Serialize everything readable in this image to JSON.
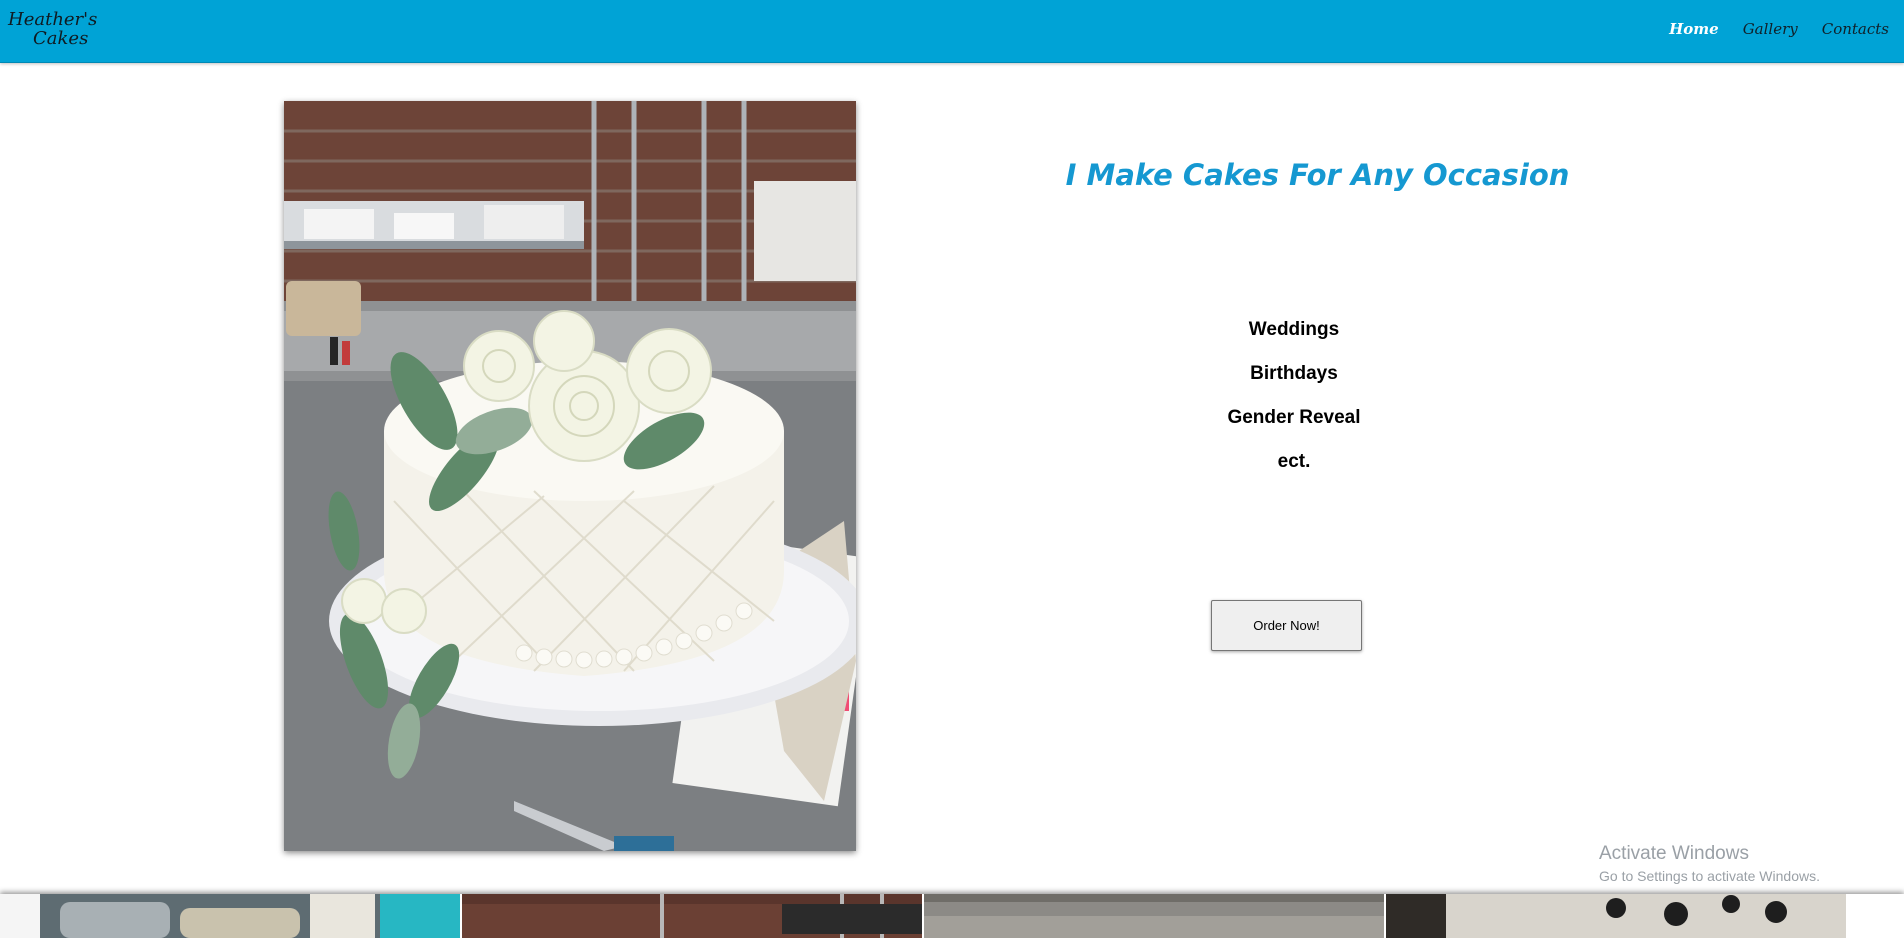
{
  "header": {
    "logo_line1": "Heather's",
    "logo_line2": "Cakes",
    "nav": [
      {
        "label": "Home",
        "active": true
      },
      {
        "label": "Gallery",
        "active": false
      },
      {
        "label": "Contacts",
        "active": false
      }
    ]
  },
  "hero": {
    "image": "white-wedding-cake-with-roses-photo",
    "headline": "I Make Cakes For Any Occasion",
    "occasions": [
      "Weddings",
      "Birthdays",
      "Gender Reveal",
      "ect."
    ],
    "order_button": "Order Now!"
  },
  "gallery_strip": {
    "thumbnails": [
      "cake-photo-1",
      "cake-photo-2",
      "cake-photo-3",
      "cake-photo-4"
    ]
  },
  "watermark": {
    "title": "Activate Windows",
    "subtitle": "Go to Settings to activate Windows."
  },
  "colors": {
    "navbar": "#00a3d6",
    "headline": "#1598d1",
    "active_nav": "#ffffff"
  }
}
